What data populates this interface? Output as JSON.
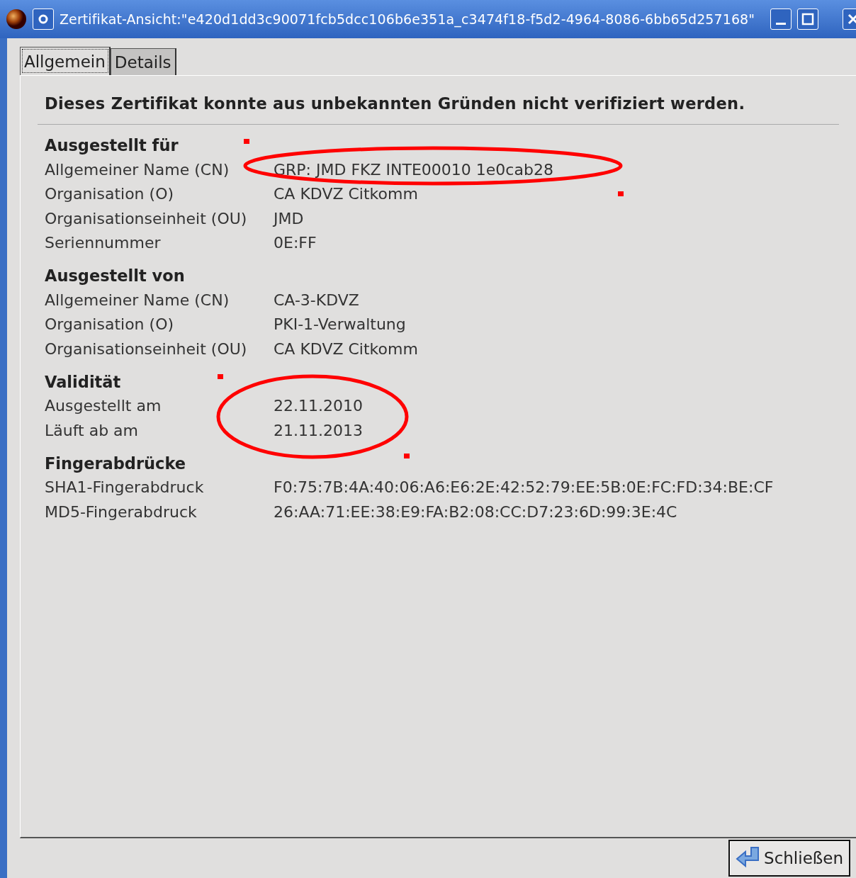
{
  "window": {
    "title": "Zertifikat-Ansicht:\"e420d1dd3c90071fcb5dcc106b6e351a_c3474f18-f5d2-4964-8086-6bb65d257168\""
  },
  "tabs": [
    {
      "label": "Allgemein",
      "selected": true
    },
    {
      "label": "Details",
      "selected": false
    }
  ],
  "message": "Dieses Zertifikat konnte aus unbekannten Gründen nicht verifiziert werden.",
  "sections": [
    {
      "title": "Ausgestellt für",
      "rows": [
        {
          "label": "Allgemeiner Name (CN)",
          "value": "GRP: JMD FKZ INTE00010 1e0cab28"
        },
        {
          "label": "Organisation (O)",
          "value": "CA KDVZ Citkomm"
        },
        {
          "label": "Organisationseinheit (OU)",
          "value": "JMD"
        },
        {
          "label": "Seriennummer",
          "value": "0E:FF"
        }
      ]
    },
    {
      "title": "Ausgestellt von",
      "rows": [
        {
          "label": "Allgemeiner Name (CN)",
          "value": "CA-3-KDVZ"
        },
        {
          "label": "Organisation (O)",
          "value": "PKI-1-Verwaltung"
        },
        {
          "label": "Organisationseinheit (OU)",
          "value": "CA KDVZ Citkomm"
        }
      ]
    },
    {
      "title": "Validität",
      "rows": [
        {
          "label": "Ausgestellt am",
          "value": "22.11.2010"
        },
        {
          "label": "Läuft ab am",
          "value": "21.11.2013"
        }
      ]
    },
    {
      "title": "Fingerabdrücke",
      "rows": [
        {
          "label": "SHA1-Fingerabdruck",
          "value": "F0:75:7B:4A:40:06:A6:E6:2E:42:52:79:EE:5B:0E:FC:FD:34:BE:CF"
        },
        {
          "label": "MD5-Fingerabdruck",
          "value": "26:AA:71:EE:38:E9:FA:B2:08:CC:D7:23:6D:99:3E:4C"
        }
      ]
    }
  ],
  "close_button": {
    "label": "Schließen"
  }
}
